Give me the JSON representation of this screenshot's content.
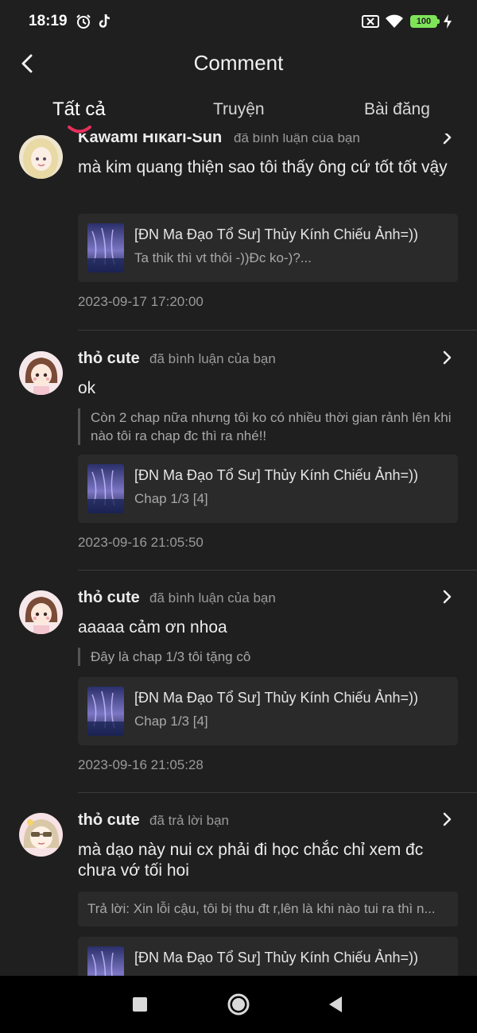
{
  "status_bar": {
    "time": "18:19",
    "battery": "100",
    "icons": [
      "alarm-icon",
      "tiktok-icon",
      "sim-off-icon",
      "wifi-icon",
      "battery-icon",
      "charging-icon"
    ]
  },
  "header": {
    "title": "Comment"
  },
  "tabs": [
    {
      "label": "Tất cả",
      "active": true
    },
    {
      "label": "Truyện",
      "active": false
    },
    {
      "label": "Bài đăng",
      "active": false
    }
  ],
  "colors": {
    "accent": "#e5305a",
    "background": "#1f1f1f",
    "card": "#2a2a2a"
  },
  "comments": [
    {
      "username": "Kawami Hikari-Sun",
      "action": "đã bình luận của bạn",
      "content": "mà kim quang thiện sao tôi thấy ông cứ tốt  tốt vậy",
      "card_title": "[ĐN Ma Đạo Tổ Sư] Thủy Kính Chiếu Ảnh=))",
      "card_sub": "Ta thik thì vt thôi -))Đc ko-)?...",
      "time": "2023-09-17 17:20:00"
    },
    {
      "username": "thỏ cute",
      "action": "đã bình luận của bạn",
      "content": "ok",
      "quote": "Còn 2 chap nữa nhưng tôi ko có nhiều thời gian rảnh lên khi nào tôi ra chap đc thì ra nhé!!",
      "card_title": "[ĐN Ma Đạo Tổ Sư] Thủy Kính Chiếu Ảnh=))",
      "card_sub": "Chap 1/3 [4]",
      "time": "2023-09-16 21:05:50"
    },
    {
      "username": "thỏ cute",
      "action": "đã bình luận của bạn",
      "content": "aaaaa cảm ơn nhoa",
      "quote": "Đây là chap 1/3 tôi tặng cô",
      "card_title": "[ĐN Ma Đạo Tổ Sư] Thủy Kính Chiếu Ảnh=))",
      "card_sub": "Chap 1/3 [4]",
      "time": "2023-09-16 21:05:28"
    },
    {
      "username": "thỏ cute",
      "action": "đã trả lời bạn",
      "content": "mà dạo này nui cx phải đi học chắc chỉ xem đc chưa vớ tối hoi",
      "reply": "Trả lời: Xin lỗi cậu, tôi bị thu đt r,lên là khi nào tui ra thì n...",
      "card_title": "[ĐN Ma Đạo Tổ Sư] Thủy Kính Chiếu Ảnh=))"
    }
  ],
  "nav": {
    "icons": [
      "recents-icon",
      "home-icon",
      "back-icon"
    ]
  }
}
